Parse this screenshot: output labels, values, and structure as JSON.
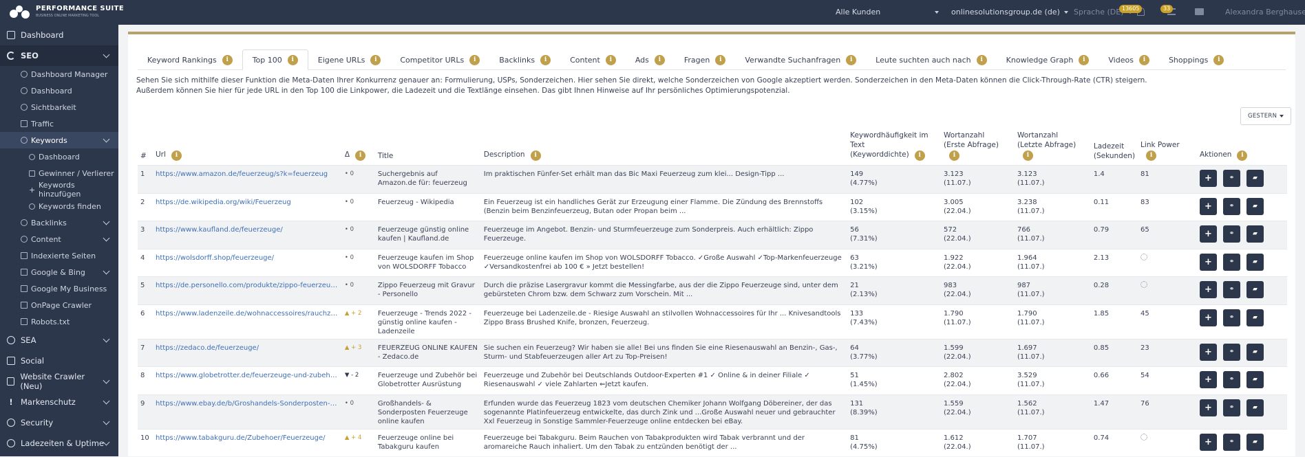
{
  "topbar": {
    "brand": "PERFORMANCE SUITE",
    "brand_tagline": "BUSINESS ONLINE MARKETING TOOL",
    "customers": "Alle Kunden",
    "domain": "onlinesolutionsgroup.de (de)",
    "language": "Sprache (DE)",
    "notif_count": "13605",
    "tasks_count": "33",
    "user": "Alexandra Berghausen"
  },
  "sidebar": {
    "dashboard": "Dashboard",
    "seo": "SEO",
    "seo_items": [
      "Dashboard Manager",
      "Dashboard",
      "Sichtbarkeit",
      "Traffic",
      "Keywords"
    ],
    "keyword_items": [
      "Dashboard",
      "Gewinner / Verlierer",
      "Keywords hinzufügen",
      "Keywords finden"
    ],
    "seo_items2": [
      "Backlinks",
      "Content",
      "Indexierte Seiten",
      "Google & Bing",
      "Google My Business",
      "OnPage Crawler",
      "Robots.txt"
    ],
    "bottom": [
      "SEA",
      "Social",
      "Website Crawler (Neu)",
      "Markenschutz",
      "Security",
      "Ladezeiten & Uptime"
    ]
  },
  "tabs": [
    "Keyword Rankings",
    "Top 100",
    "Eigene URLs",
    "Competitor URLs",
    "Backlinks",
    "Content",
    "Ads",
    "Fragen",
    "Verwandte Suchanfragen",
    "Leute suchten auch nach",
    "Knowledge Graph",
    "Videos",
    "Shoppings"
  ],
  "description": {
    "line1": "Sehen Sie sich mithilfe dieser Funktion die Meta-Daten Ihrer Konkurrenz genauer an: Formulierung, USPs, Sonderzeichen. Hier sehen Sie direkt, welche Sonderzeichen von Google akzeptiert werden. Sonderzeichen in den Meta-Daten können die Click-Through-Rate (CTR) steigern.",
    "line2": "Außerdem können Sie hier für jede URL in den Top 100 die Linkpower, die Ladezeit und die Textlänge einsehen. Das gibt Ihnen Hinweise auf Ihr persönliches Optimierungspotenzial."
  },
  "date_button": "GESTERN",
  "table": {
    "headers": {
      "num": "#",
      "url": "Url",
      "delta": "Δ",
      "title": "Title",
      "description": "Description",
      "kw1": "Keywordhäufigkeit im Text",
      "kw2": "(Keyworddichte)",
      "wz1_1": "Wortanzahl",
      "wz1_2": "(Erste Abfrage)",
      "wz2_1": "Wortanzahl",
      "wz2_2": "(Letzte Abfrage)",
      "lz1": "Ladezeit",
      "lz2": "(Sekunden)",
      "lp": "Link Power",
      "actions": "Aktionen"
    },
    "rows": [
      {
        "n": "1",
        "url": "https://www.amazon.de/feuerzeug/s?k=feuerzeug",
        "delta": "• 0",
        "dir": "flat",
        "title": "Suchergebnis auf Amazon.de für: feuerzeug",
        "desc": "Im praktischen Fünfer-Set erhält man das Bic Maxi Feuerzeug zum klei... Design-Tipp ...",
        "kw": "149",
        "kwd": "(4.77%)",
        "w1": "3.123",
        "w1d": "(11.07.)",
        "w2": "3.123",
        "w2d": "(11.07.)",
        "lz": "1.4",
        "lp": "81"
      },
      {
        "n": "2",
        "url": "https://de.wikipedia.org/wiki/Feuerzeug",
        "delta": "• 0",
        "dir": "flat",
        "title": "Feuerzeug - Wikipedia",
        "desc": "Ein Feuerzeug ist ein handliches Gerät zur Erzeugung einer Flamme. Die Zündung des Brennstoffs (Benzin beim Benzinfeuerzeug, Butan oder Propan beim ...",
        "kw": "102",
        "kwd": "(3.15%)",
        "w1": "3.005",
        "w1d": "(22.04.)",
        "w2": "3.238",
        "w2d": "(11.07.)",
        "lz": "0.11",
        "lp": "83"
      },
      {
        "n": "3",
        "url": "https://www.kaufland.de/feuerzeuge/",
        "delta": "• 0",
        "dir": "flat",
        "title": "Feuerzeuge günstig online kaufen | Kaufland.de",
        "desc": "Feuerzeuge im Angebot. Benzin- und Sturmfeuerzeuge zum Sonderpreis. Auch erhältlich: Zippo Feuerzeuge.",
        "kw": "56",
        "kwd": "(7.31%)",
        "w1": "572",
        "w1d": "(22.04.)",
        "w2": "766",
        "w2d": "(11.07.)",
        "lz": "0.79",
        "lp": "65"
      },
      {
        "n": "4",
        "url": "https://wolsdorff.shop/feuerzeuge/",
        "delta": "• 0",
        "dir": "flat",
        "title": "Feuerzeuge kaufen im Shop von WOLSDORFF Tobacco",
        "desc": "Feuerzeuge online kaufen im Shop von WOLSDORFF Tobacco. ✓Große Auswahl ✓Top-Markenfeuerzeuge ✓Versandkostenfrei ab 100 € » Jetzt bestellen!",
        "kw": "63",
        "kwd": "(3.21%)",
        "w1": "1.922",
        "w1d": "(22.04.)",
        "w2": "1.964",
        "w2d": "(11.07.)",
        "lz": "2.13",
        "lp": ""
      },
      {
        "n": "5",
        "url": "https://de.personello.com/produkte/zippo-feuerzeug...",
        "delta": "• 0",
        "dir": "flat",
        "title": "Zippo Feuerzeug mit Gravur - Personello",
        "desc": "Durch die präzise Lasergravur kommt die Messingfarbe, aus der die Zippo Feuerzeuge sind, unter dem gebürsteten Chrom bzw. dem Schwarz zum Vorschein. Mit ...",
        "kw": "21",
        "kwd": "(2.13%)",
        "w1": "983",
        "w1d": "(22.04.)",
        "w2": "987",
        "w2d": "(11.07.)",
        "lz": "0.28",
        "lp": ""
      },
      {
        "n": "6",
        "url": "https://www.ladenzeile.de/wohnaccessoires/rauchzub...",
        "delta": "▲ + 2",
        "dir": "up",
        "title": "Feuerzeuge - Trends 2022 - günstig online kaufen - Ladenzeile",
        "desc": "Feuerzeuge bei Ladenzeile.de - Riesige Auswahl an stilvollen Wohnaccessoires für Ihr ... Knivesandtools Zippo Brass Brushed Knife, bronzen, Feuerzeug.",
        "kw": "133",
        "kwd": "(7.43%)",
        "w1": "1.790",
        "w1d": "(11.07.)",
        "w2": "1.790",
        "w2d": "(11.07.)",
        "lz": "1.85",
        "lp": "45"
      },
      {
        "n": "7",
        "url": "https://zedaco.de/feuerzeuge/",
        "delta": "▲ + 3",
        "dir": "up",
        "title": "FEUERZEUG ONLINE KAUFEN - Zedaco.de",
        "desc": "Sie suchen ein Feuerzeug? Wir haben sie alle! Bei uns finden Sie eine Riesenauswahl an Benzin-, Gas-, Sturm- und Stabfeuerzeugen aller Art zu Top-Preisen!",
        "kw": "64",
        "kwd": "(3.77%)",
        "w1": "1.599",
        "w1d": "(22.04.)",
        "w2": "1.697",
        "w2d": "(11.07.)",
        "lz": "0.85",
        "lp": "23"
      },
      {
        "n": "8",
        "url": "https://www.globetrotter.de/feuerzeuge-und-zubehoe...",
        "delta": "▼ - 2",
        "dir": "down",
        "title": "Feuerzeuge und Zubehör bei Globetrotter Ausrüstung",
        "desc": "Feuerzeuge und Zubehör bei Deutschlands Outdoor-Experten #1 ✓ Online & in deiner Filiale ✓ Riesenauswahl ✓ viele Zahlarten ⇐Jetzt kaufen.",
        "kw": "51",
        "kwd": "(1.45%)",
        "w1": "2.802",
        "w1d": "(22.04.)",
        "w2": "3.529",
        "w2d": "(11.07.)",
        "lz": "0.66",
        "lp": "54"
      },
      {
        "n": "9",
        "url": "https://www.ebay.de/b/Groshandels-Sonderposten-Feu...",
        "delta": "• 0",
        "dir": "flat",
        "title": "Großhandels- & Sonderposten Feuerzeuge online kaufen",
        "desc": "Erfunden wurde das Feuerzeug 1823 vom deutschen Chemiker Johann Wolfgang Döbereiner, der das sogenannte Platinfeuerzeug entwickelte, das durch Zink und ...Große Auswahl neuer und gebrauchter Xxl Feuerzeug in Sonstige Sammler-Feuerzeuge online entdecken bei eBay.",
        "kw": "131",
        "kwd": "(8.39%)",
        "w1": "1.559",
        "w1d": "(22.04.)",
        "w2": "1.562",
        "w2d": "(11.07.)",
        "lz": "1.47",
        "lp": "76"
      },
      {
        "n": "10",
        "url": "https://www.tabakguru.de/Zubehoer/Feuerzeuge/",
        "delta": "▲ + 4",
        "dir": "up",
        "title": "Feuerzeuge online bei Tabakguru kaufen",
        "desc": "Feuerzeuge bei Tabakguru. Beim Rauchen von Tabakprodukten wird Tabak verbrannt und der aromareiche Rauch inhaliert. Um den Tabak zu entzünden benötigt der ...",
        "kw": "81",
        "kwd": "(4.75%)",
        "w1": "1.612",
        "w1d": "(22.04.)",
        "w2": "1.707",
        "w2d": "(11.07.)",
        "lz": "0.74",
        "lp": ""
      }
    ]
  }
}
